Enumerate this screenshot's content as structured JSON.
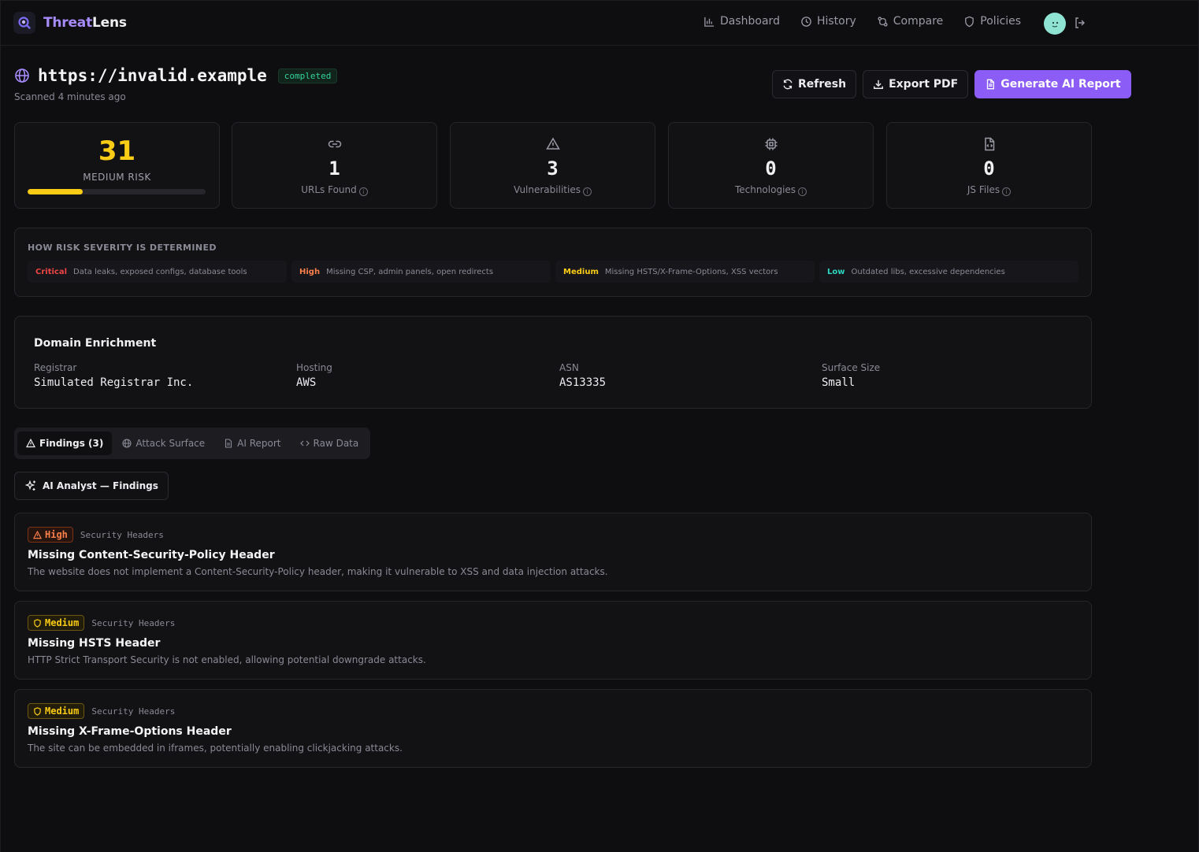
{
  "app": {
    "name_a": "Threat",
    "name_b": "Lens"
  },
  "nav": [
    {
      "label": "Dashboard",
      "icon": "bar-chart-icon"
    },
    {
      "label": "History",
      "icon": "clock-icon"
    },
    {
      "label": "Compare",
      "icon": "git-compare-icon"
    },
    {
      "label": "Policies",
      "icon": "shield-icon"
    }
  ],
  "scan": {
    "url": "https://invalid.example",
    "status": "completed",
    "scanned": "Scanned 4 minutes ago"
  },
  "actions": {
    "refresh": "Refresh",
    "export": "Export PDF",
    "generate": "Generate AI Report"
  },
  "risk": {
    "score": "31",
    "label": "MEDIUM RISK",
    "fill_fraction": 0.31,
    "color": "#facc15"
  },
  "stats": [
    {
      "value": "1",
      "label": "URLs Found",
      "icon": "link-icon"
    },
    {
      "value": "3",
      "label": "Vulnerabilities",
      "icon": "alert-triangle-icon"
    },
    {
      "value": "0",
      "label": "Technologies",
      "icon": "cpu-icon"
    },
    {
      "value": "0",
      "label": "JS Files",
      "icon": "file-code-icon"
    }
  ],
  "severity": {
    "title": "HOW RISK SEVERITY IS DETERMINED",
    "levels": [
      {
        "level": "Critical",
        "desc": "Data leaks, exposed configs, database tools",
        "color": "#ef4444"
      },
      {
        "level": "High",
        "desc": "Missing CSP, admin panels, open redirects",
        "color": "#fb7f4b"
      },
      {
        "level": "Medium",
        "desc": "Missing HSTS/X-Frame-Options, XSS vectors",
        "color": "#facc15"
      },
      {
        "level": "Low",
        "desc": "Outdated libs, excessive dependencies",
        "color": "#2dd4bf"
      }
    ]
  },
  "enrichment": {
    "title": "Domain Enrichment",
    "fields": [
      {
        "key": "Registrar",
        "value": "Simulated Registrar Inc."
      },
      {
        "key": "Hosting",
        "value": "AWS"
      },
      {
        "key": "ASN",
        "value": "AS13335"
      },
      {
        "key": "Surface Size",
        "value": "Small"
      }
    ]
  },
  "tabs": [
    {
      "label": "Findings (3)",
      "icon": "alert-triangle-icon",
      "active": true
    },
    {
      "label": "Attack Surface",
      "icon": "globe-icon",
      "active": false
    },
    {
      "label": "AI Report",
      "icon": "file-text-icon",
      "active": false
    },
    {
      "label": "Raw Data",
      "icon": "code-icon",
      "active": false
    }
  ],
  "ai_button": "AI Analyst — Findings",
  "findings": [
    {
      "severity": "High",
      "category": "Security Headers",
      "title": "Missing Content-Security-Policy Header",
      "description": "The website does not implement a Content-Security-Policy header, making it vulnerable to XSS and data injection attacks."
    },
    {
      "severity": "Medium",
      "category": "Security Headers",
      "title": "Missing HSTS Header",
      "description": "HTTP Strict Transport Security is not enabled, allowing potential downgrade attacks."
    },
    {
      "severity": "Medium",
      "category": "Security Headers",
      "title": "Missing X-Frame-Options Header",
      "description": "The site can be embedded in iframes, potentially enabling clickjacking attacks."
    }
  ]
}
